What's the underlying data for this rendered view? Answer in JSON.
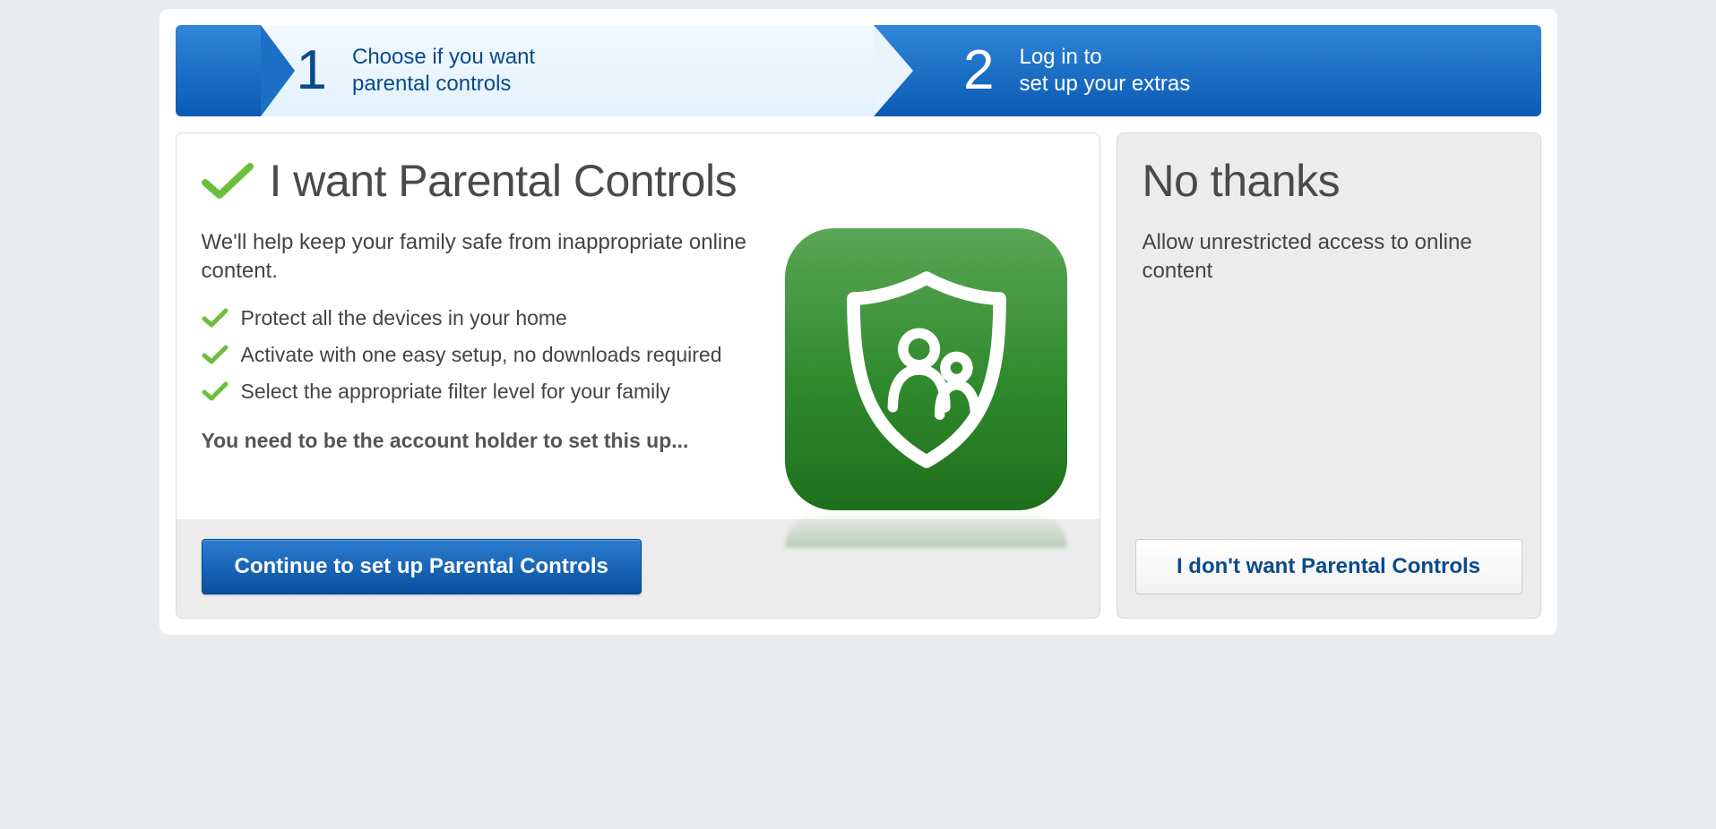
{
  "steps": [
    {
      "num": "1",
      "line1": "Choose if you want",
      "line2": "parental controls"
    },
    {
      "num": "2",
      "line1": "Log in to",
      "line2": "set up your extras"
    }
  ],
  "want": {
    "title": "I want Parental Controls",
    "lead": "We'll help keep your family safe from inappropriate online content.",
    "benefits": [
      "Protect all the devices in your home",
      "Activate with one easy setup, no downloads required",
      "Select the appropriate filter level for your family"
    ],
    "note": "You need to be the account holder to set this up...",
    "cta": "Continue to set up Parental Controls"
  },
  "nothanks": {
    "title": "No thanks",
    "lead": "Allow unrestricted access to online content",
    "cta": "I don't want Parental Controls"
  },
  "colors": {
    "check": "#6cbf3b"
  }
}
